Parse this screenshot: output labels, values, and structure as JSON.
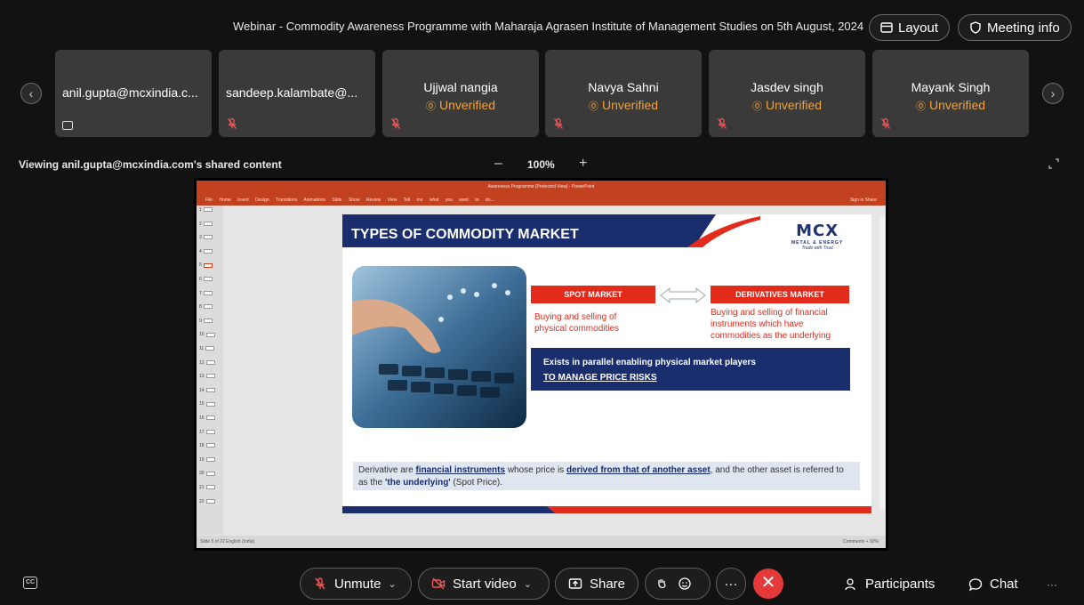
{
  "header": {
    "meeting_title": "Webinar - Commodity Awareness Programme with Maharaja Agrasen Institute of Management Studies on 5th August, 2024",
    "layout_label": "Layout",
    "meeting_info_label": "Meeting info"
  },
  "participants": [
    {
      "name": "anil.gupta@mcxindia.c...",
      "status": "",
      "indicator": "screen-share-icon"
    },
    {
      "name": "sandeep.kalambate@...",
      "status": "",
      "indicator": "mic-muted-icon"
    },
    {
      "name": "Ujjwal nangia",
      "status": "Unverified",
      "indicator": "mic-muted-icon"
    },
    {
      "name": "Navya Sahni",
      "status": "Unverified",
      "indicator": "mic-muted-icon"
    },
    {
      "name": "Jasdev singh",
      "status": "Unverified",
      "indicator": "mic-muted-icon"
    },
    {
      "name": "Mayank Singh",
      "status": "Unverified",
      "indicator": "mic-muted-icon"
    }
  ],
  "status_icon_glyph": "⓪",
  "share": {
    "viewing_text": "Viewing anil.gupta@mcxindia.com's shared content",
    "zoom_minus": "–",
    "zoom_level": "100%",
    "zoom_plus": "+"
  },
  "ppt": {
    "window_title": "Awareness Programme [Protected View] - PowerPoint",
    "ribbon_tabs": "File Home Insert Design Transitions Animations Slide Show Review View  Tell me what you want to do...",
    "ribbon_right": "Sign in  Share",
    "thumb_numbers": [
      "1",
      "2",
      "3",
      "4",
      "5",
      "6",
      "7",
      "8",
      "9",
      "10",
      "11",
      "12",
      "13",
      "14",
      "15",
      "16",
      "17",
      "18",
      "19",
      "20",
      "21",
      "22"
    ],
    "status_left": "Slide 5 of 22   English (India)",
    "status_right": "Comments          +  92%"
  },
  "slide": {
    "title": "TYPES OF COMMODITY MARKET",
    "logo_text": "MCX",
    "logo_sub": "METAL & ENERGY",
    "logo_tag": "Trade with Trust",
    "spot_label": "SPOT MARKET",
    "derivatives_label": "DERIVATIVES MARKET",
    "spot_desc": "Buying and selling of physical commodities",
    "derivatives_desc": "Buying and selling of financial instruments which have commodities as the underlying",
    "navy_line1": "Exists in parallel enabling physical market players",
    "navy_line2": "TO MANAGE PRICE RISKS",
    "bottom_part1": "Derivative are ",
    "bottom_bold1": "financial instruments",
    "bottom_part2": " whose price is ",
    "bottom_bold2": "derived from that of another asset",
    "bottom_part3": ", and the other asset is referred to as the ",
    "bottom_bold3": "'the underlying'",
    "bottom_part4": " (Spot Price).",
    "colors": {
      "navy": "#1a2d6d",
      "red": "#e32b1c"
    }
  },
  "toolbar": {
    "cc_label": "CC",
    "unmute_label": "Unmute",
    "start_video_label": "Start video",
    "share_label": "Share",
    "participants_label": "Participants",
    "chat_label": "Chat",
    "more_label": "···",
    "leave_label": "✕"
  }
}
